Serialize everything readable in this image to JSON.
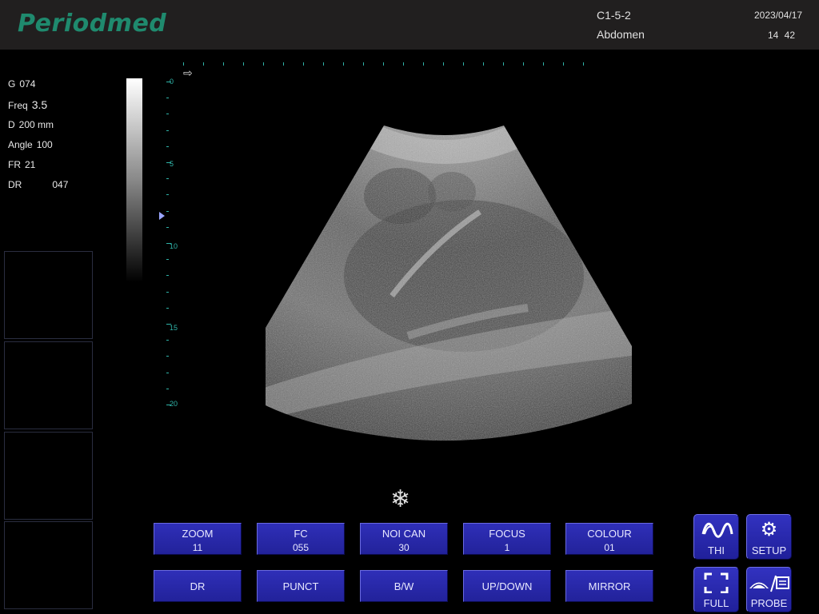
{
  "header": {
    "logo": "Periodmed",
    "probe": "C1-5-2",
    "exam": "Abdomen",
    "date": "2023/04/17",
    "time": "14 42"
  },
  "params": [
    {
      "label": "G",
      "value": "074"
    },
    {
      "label": "Freq",
      "value": "3.5"
    },
    {
      "label": "D",
      "value": "200 mm"
    },
    {
      "label": "Angle",
      "value": "100"
    },
    {
      "label": "FR",
      "value": "21"
    },
    {
      "label": "DR",
      "value": "047"
    }
  ],
  "depth_scale": {
    "labels": [
      "0",
      "5",
      "10",
      "15",
      "20"
    ],
    "unit_max": 20
  },
  "icons": {
    "freeze": "snowflake-icon",
    "arrow": "right-arrow-icon",
    "thi": "wave-icon",
    "setup": "gear-icon",
    "full": "fullscreen-icon",
    "probe": "probe-icon"
  },
  "colors": {
    "button": "#2626a8",
    "accent": "#2fb3a8",
    "logo": "#1f8a6e"
  },
  "buttons_row1": [
    {
      "label": "ZOOM",
      "value": "11"
    },
    {
      "label": "FC",
      "value": "055"
    },
    {
      "label": "NOI CAN",
      "value": "30"
    },
    {
      "label": "FOCUS",
      "value": "1"
    },
    {
      "label": "COLOUR",
      "value": "01"
    }
  ],
  "buttons_row2": [
    {
      "label": "DR"
    },
    {
      "label": "PUNCT"
    },
    {
      "label": "B/W"
    },
    {
      "label": "UP/DOWN"
    },
    {
      "label": "MIRROR"
    }
  ],
  "icon_buttons": {
    "thi": "THI",
    "setup": "SETUP",
    "full": "FULL",
    "probe": "PROBE"
  }
}
